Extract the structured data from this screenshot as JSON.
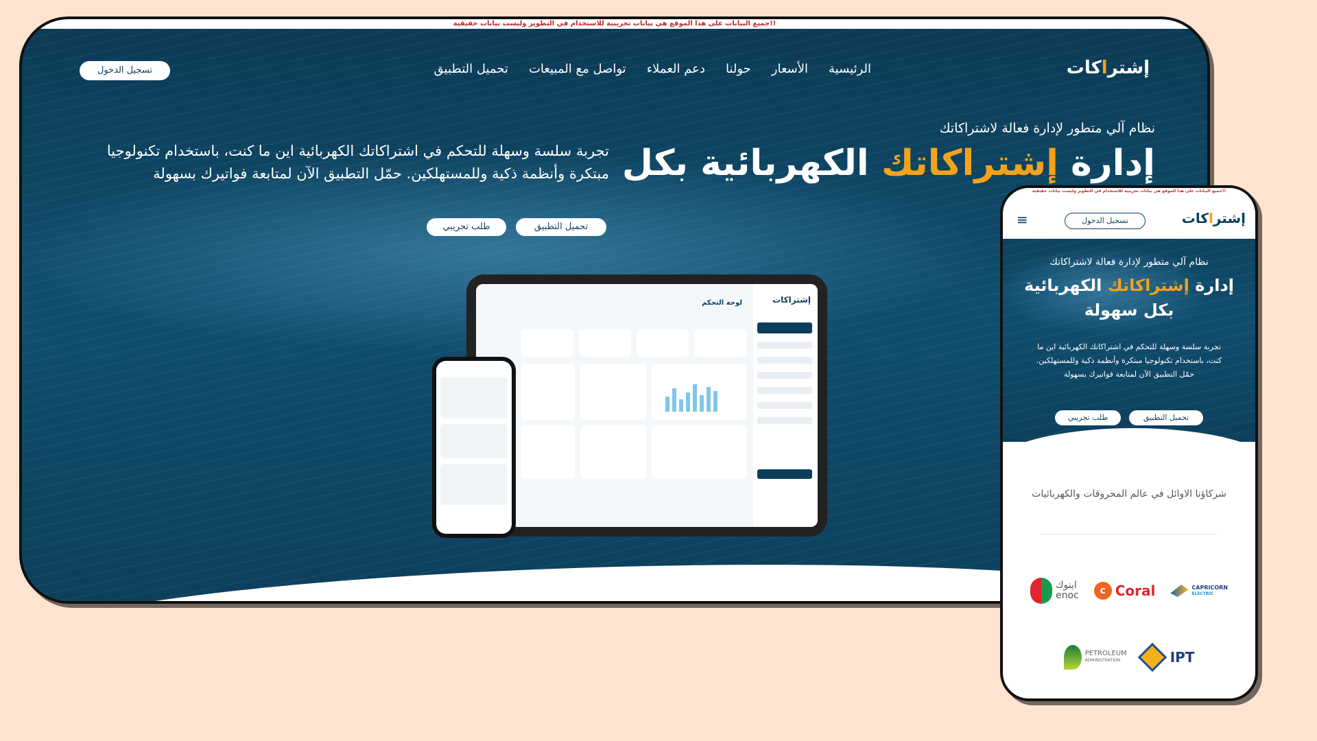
{
  "banner": "جميع البيانات على هذا الموقع هي بيانات تجريبية للاستخدام في التطوير وليست بيانات حقيقية!!",
  "brand": {
    "logo_main": "إشتر",
    "logo_accent": "ا",
    "logo_end": "كات"
  },
  "nav": {
    "items": [
      "الرئيسية",
      "الأسعار",
      "حولنا",
      "دعم العملاء",
      "تواصل مع المبيعات",
      "تحميل التطبيق"
    ],
    "login": "تسجيل الدخول"
  },
  "hero": {
    "subtitle": "نظام آلي متطور لإدارة فعالة لاشتراكاتك",
    "title_start": "إدارة ",
    "title_accent": "إشتراكاتك",
    "title_end": " الكهربائية بكل",
    "description": "تجربة سلسة وسهلة للتحكم في اشتراكاتك الكهربائية اين ما كنت، باستخدام تكنولوجيا مبتكرة وأنظمة ذكية وللمستهلكين. حمّل التطبيق الآن لمتابعة فواتيرك بسهولة",
    "download_button": "تحميل التطبيق",
    "trial_button": "طلب تجريبي"
  },
  "dashboard": {
    "logo": "إشتراكات",
    "title": "لوحة التحكم"
  },
  "mobile": {
    "banner": "جميع البيانات على هذا الموقع هي بيانات تجريبية للاستخدام في التطوير وليست بيانات حقيقية!!",
    "login": "تسجيل الدخول",
    "subtitle": "نظام آلي متطور لإدارة فعالة لاشتراكاتك",
    "title_start": "إدارة ",
    "title_accent": "إشتراكاتك",
    "title_end": " الكهربائية بكل سهولة",
    "description": "تجربة سلسة وسهلة للتحكم في اشتراكاتك الكهربائية اين ما كنت، باستخدام تكنولوجيا مبتكرة وأنظمة ذكية وللمستهلكين. حمّل التطبيق الآن لمتابعة فواتيرك بسهولة",
    "download_button": "تحميل التطبيق",
    "trial_button": "طلب تجريبي",
    "partners_title": "شركاؤنا الاوائل في عالم المحروقات والكهربائيات",
    "partners": {
      "enoc_ar": "اينوك",
      "enoc_en": "enoc",
      "coral": "Coral",
      "capricorn": "CAPRICORN",
      "capricorn_sub": "ELECTRIC",
      "petroleum": "PETROLEUM",
      "petroleum_sub": "ADMINISTRATION",
      "ipt": "IPT"
    }
  },
  "colors": {
    "background": "#fde3d0",
    "hero_dark": "#0c3f5c",
    "accent": "#f3a21c",
    "banner_text": "#c0292a"
  }
}
